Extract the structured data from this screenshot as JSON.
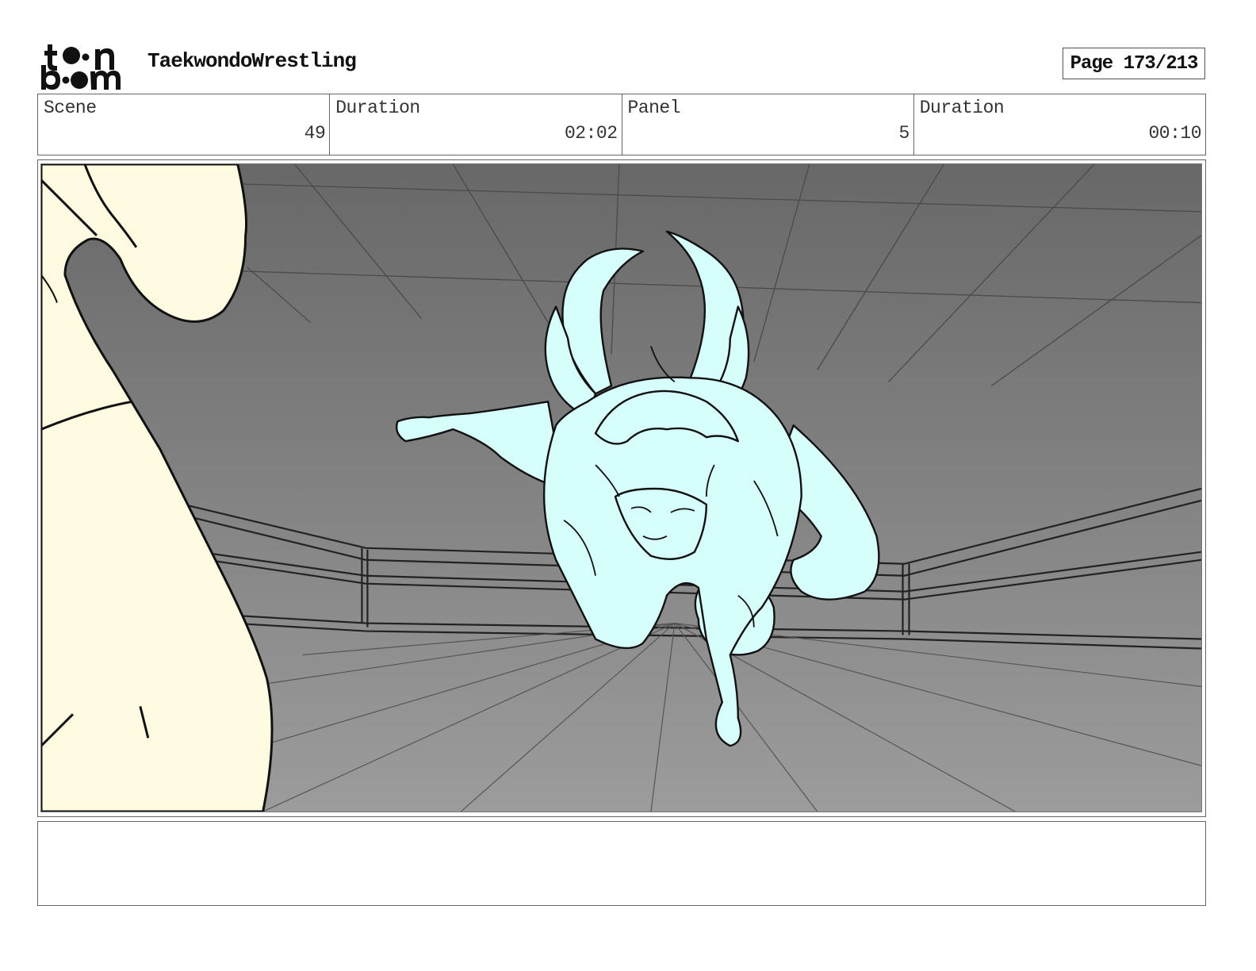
{
  "header": {
    "logo_icon": "toon-boom-logo",
    "project_title": "TaekwondoWrestling",
    "page_label": "Page 173/213"
  },
  "info": {
    "scene_label": "Scene",
    "scene_value": "49",
    "scene_duration_label": "Duration",
    "scene_duration_value": "02:02",
    "panel_label": "Panel",
    "panel_value": "5",
    "panel_duration_label": "Duration",
    "panel_duration_value": "00:10"
  },
  "colors": {
    "background_top": "#6a6a6a",
    "background_bottom": "#9a9a9a",
    "foreground_character": "#fffbe0",
    "main_character": "#d6fefb",
    "line": "#111111"
  }
}
